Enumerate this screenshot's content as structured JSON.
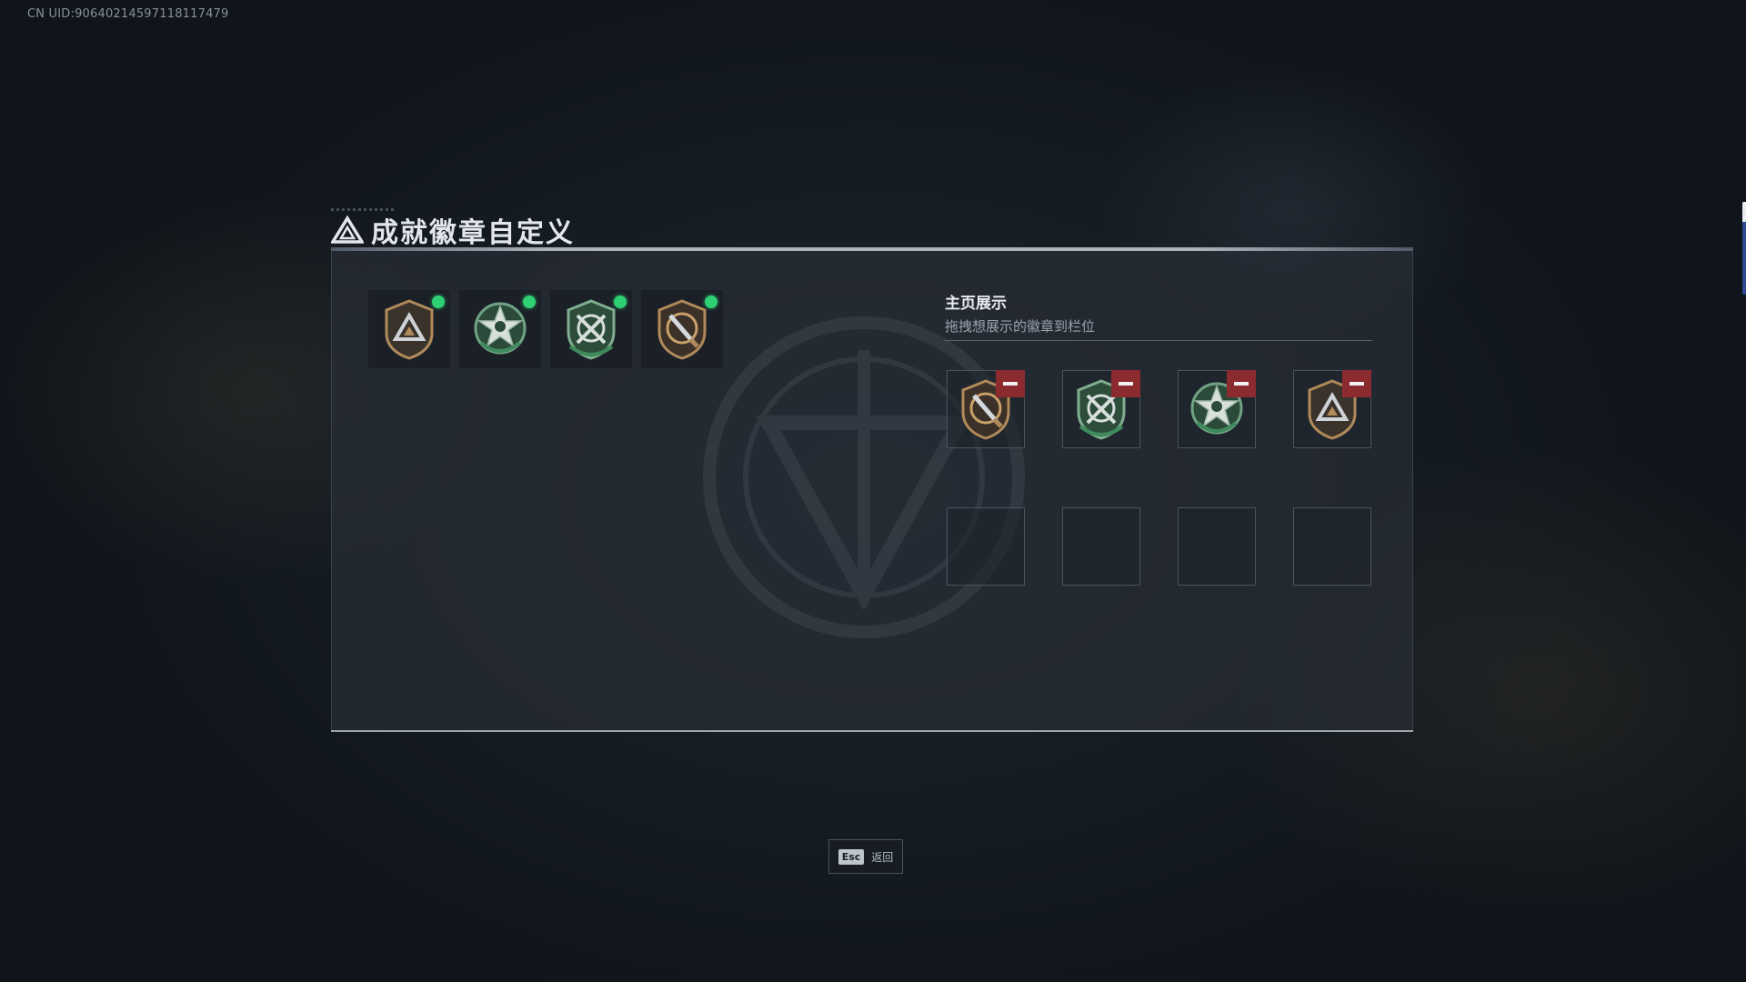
{
  "uid_text": "CN UID:90640214597118117479",
  "page": {
    "title": "成就徽章自定义"
  },
  "inventory": {
    "items": [
      {
        "badge": "bronze-triangle-shield-icon",
        "status": "new"
      },
      {
        "badge": "green-star-wreath-icon",
        "status": "new"
      },
      {
        "badge": "green-crossed-shield-icon",
        "status": "new"
      },
      {
        "badge": "bronze-blade-shield-icon",
        "status": "new"
      }
    ]
  },
  "display": {
    "title": "主页展示",
    "subtitle": "拖拽想展示的徽章到栏位",
    "slots": [
      {
        "badge": "bronze-blade-shield-icon",
        "removable": true
      },
      {
        "badge": "green-crossed-shield-icon",
        "removable": true
      },
      {
        "badge": "green-star-wreath-icon",
        "removable": true
      },
      {
        "badge": "bronze-triangle-shield-icon",
        "removable": true
      },
      {
        "badge": null
      },
      {
        "badge": null
      },
      {
        "badge": null
      },
      {
        "badge": null
      }
    ]
  },
  "footer": {
    "esc_key": "Esc",
    "esc_label": "返回"
  },
  "colors": {
    "new_dot": "#2fd074",
    "remove_button": "#8b2a2f",
    "bronze": "#b08a5a",
    "green": "#3f8a5c"
  }
}
